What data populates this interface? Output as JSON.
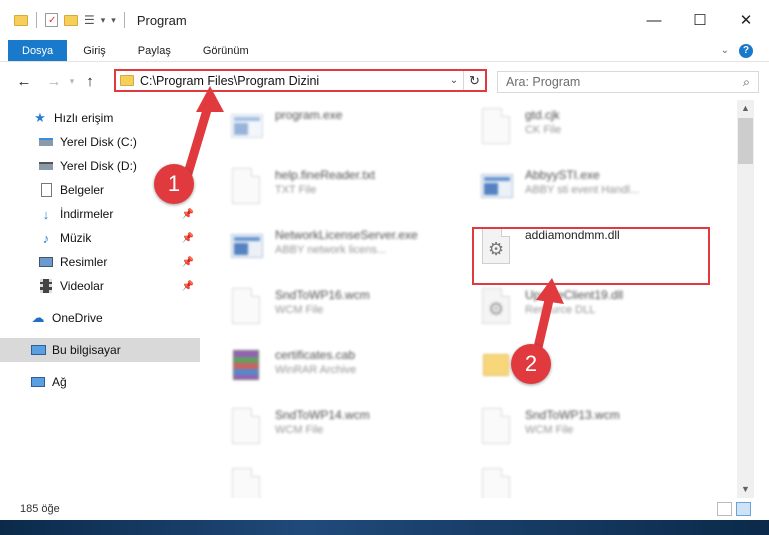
{
  "window": {
    "title": "Program",
    "controls": {
      "minimize": "—",
      "maximize": "☐",
      "close": "✕"
    }
  },
  "ribbon": {
    "tabs": [
      "Dosya",
      "Giriş",
      "Paylaş",
      "Görünüm"
    ]
  },
  "nav": {
    "back": "←",
    "forward": "→",
    "up": "↑",
    "address": "C:\\Program Files\\Program Dizini",
    "search_placeholder": "Ara: Program"
  },
  "sidebar": {
    "items": [
      {
        "label": "Hızlı erişim",
        "icon": "star-icon",
        "pinned": false
      },
      {
        "label": "Yerel Disk (C:)",
        "icon": "drive-icon",
        "pinned": false
      },
      {
        "label": "Yerel Disk (D:)",
        "icon": "drive-icon",
        "pinned": false
      },
      {
        "label": "Belgeler",
        "icon": "documents-icon",
        "pinned": false
      },
      {
        "label": "İndirmeler",
        "icon": "download-icon",
        "pinned": true
      },
      {
        "label": "Müzik",
        "icon": "music-icon",
        "pinned": true
      },
      {
        "label": "Resimler",
        "icon": "pictures-icon",
        "pinned": true
      },
      {
        "label": "Videolar",
        "icon": "video-icon",
        "pinned": true
      },
      {
        "label": "OneDrive",
        "icon": "cloud-icon",
        "pinned": false
      },
      {
        "label": "Bu bilgisayar",
        "icon": "computer-icon",
        "pinned": false,
        "selected": true
      },
      {
        "label": "Ağ",
        "icon": "network-icon",
        "pinned": false
      }
    ]
  },
  "files": [
    {
      "name": "program.exe",
      "type": "",
      "icon": "exe-icon"
    },
    {
      "name": "gtd.cjk",
      "type": "CK File",
      "icon": "file-icon"
    },
    {
      "name": "help.fineReader.txt",
      "type": "TXT File",
      "icon": "file-icon"
    },
    {
      "name": "AbbyySTI.exe",
      "type": "ABBY sti event Handl...",
      "icon": "exe-icon"
    },
    {
      "name": "NetworkLicenseServer.exe",
      "type": "ABBY network licens...",
      "icon": "exe-icon"
    },
    {
      "name": "addiamondmm.dll",
      "type": "",
      "icon": "dll-gear-icon"
    },
    {
      "name": "SndToWP16.wcm",
      "type": "WCM File",
      "icon": "file-icon"
    },
    {
      "name": "UpdateClient19.dll",
      "type": "Resource DLL",
      "icon": "dll-gear-icon"
    },
    {
      "name": "certificates.cab",
      "type": "WinRAR Archive",
      "icon": "rar-icon"
    },
    {
      "name": "",
      "type": "",
      "icon": "folder-icon"
    },
    {
      "name": "SndToWP14.wcm",
      "type": "WCM File",
      "icon": "file-icon"
    },
    {
      "name": "SndToWP13.wcm",
      "type": "WCM File",
      "icon": "file-icon"
    },
    {
      "name": "",
      "type": "",
      "icon": "file-icon"
    },
    {
      "name": "",
      "type": "",
      "icon": "file-icon"
    }
  ],
  "status": {
    "item_count": "185 öğe"
  },
  "annotations": {
    "step1": "1",
    "step2": "2",
    "accent_color": "#e0393e"
  }
}
